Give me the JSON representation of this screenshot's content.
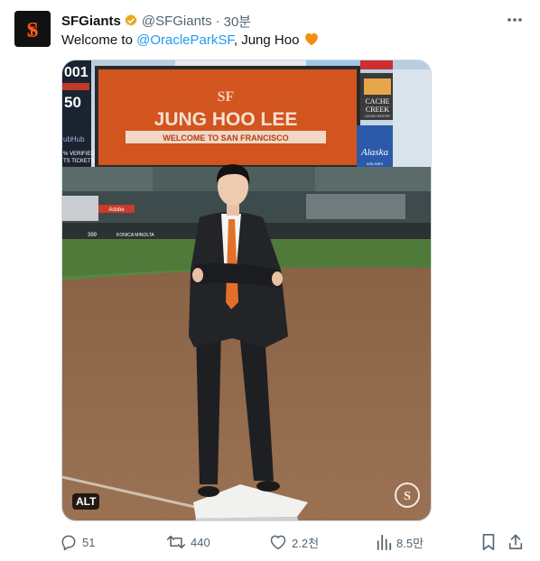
{
  "tweet": {
    "display_name": "SFGiants",
    "handle": "@SFGiants",
    "separator": "·",
    "time": "30분",
    "text_prefix": "Welcome to ",
    "mention": "@OracleParkSF",
    "text_suffix": ", Jung Hoo ",
    "emoji_heart_color": "#f4900c"
  },
  "media": {
    "scoreboard_title": "JUNG HOO LEE",
    "scoreboard_subtitle": "WELCOME TO SAN FRANCISCO",
    "ad_cache_creek_1": "CACHE",
    "ad_cache_creek_2": "CREEK",
    "ad_cache_creek_3": "CASINO RESORT",
    "ad_alaska": "Alaska",
    "ad_alaska_sub": "AIRLINES",
    "ad_adobe": "Adobe",
    "ad_konica": "KONICA MINOLTA",
    "left_board_1": "001",
    "left_board_2": "50",
    "left_board_3": "ubHub",
    "left_board_4": "% VERIFIED",
    "left_board_5": "TS TICKETS",
    "left_board_6": "399",
    "alt_badge": "ALT"
  },
  "actions": {
    "replies": "51",
    "retweets": "440",
    "likes": "2.2천",
    "views": "8.5만"
  },
  "colors": {
    "accent": "#1d9bf0",
    "muted": "#536471",
    "giants_orange": "#fd5a1e",
    "scoreboard_orange": "#d2541f"
  },
  "icons": {
    "more": "more-dots-icon",
    "verified": "verified-badge-icon",
    "reply": "reply-icon",
    "retweet": "retweet-icon",
    "like": "heart-icon",
    "views": "views-chart-icon",
    "bookmark": "bookmark-icon",
    "share": "share-icon"
  }
}
